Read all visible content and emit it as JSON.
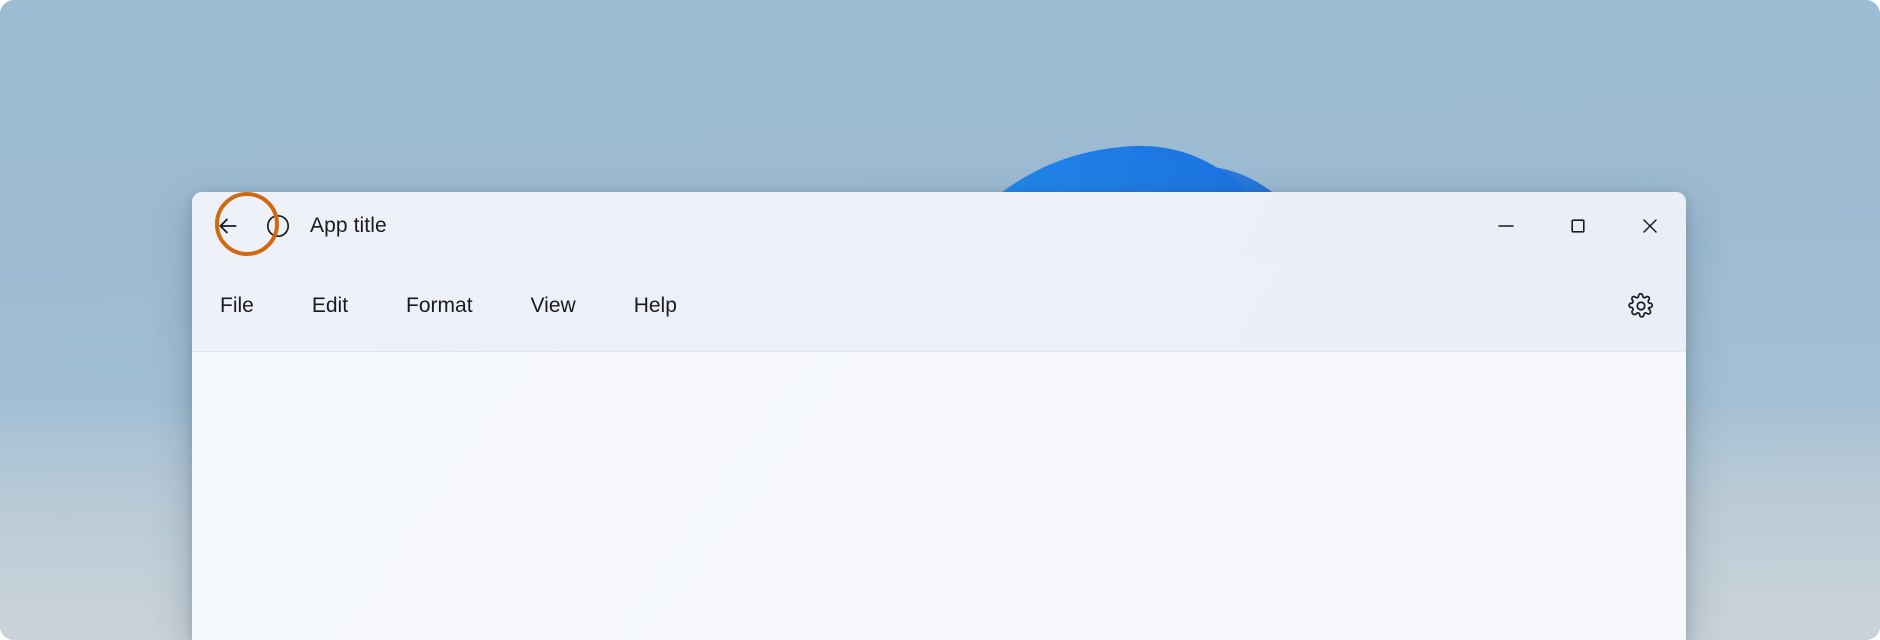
{
  "desktop": {
    "wallpaper_name": "windows-bloom-wallpaper",
    "sky_top_color": "#9cbcd4",
    "sky_bottom_color": "#c2cdd5",
    "petal_color_light": "#53b6f7",
    "petal_color_mid": "#2e95ef",
    "petal_color_deep": "#1766d8"
  },
  "window": {
    "titlebar": {
      "back_button_label": "back-arrow",
      "app_icon_label": "circle-app-icon",
      "title": "App title",
      "annotation": {
        "type": "highlight-ring",
        "target": "back-button",
        "color": "#cf6a11"
      },
      "controls": {
        "minimize_label": "Minimize",
        "maximize_label": "Maximize",
        "close_label": "Close"
      }
    },
    "menubar": {
      "items": [
        {
          "label": "File"
        },
        {
          "label": "Edit"
        },
        {
          "label": "Format"
        },
        {
          "label": "View"
        },
        {
          "label": "Help"
        }
      ],
      "settings_label": "Settings"
    },
    "content": {
      "body_text": ""
    }
  }
}
